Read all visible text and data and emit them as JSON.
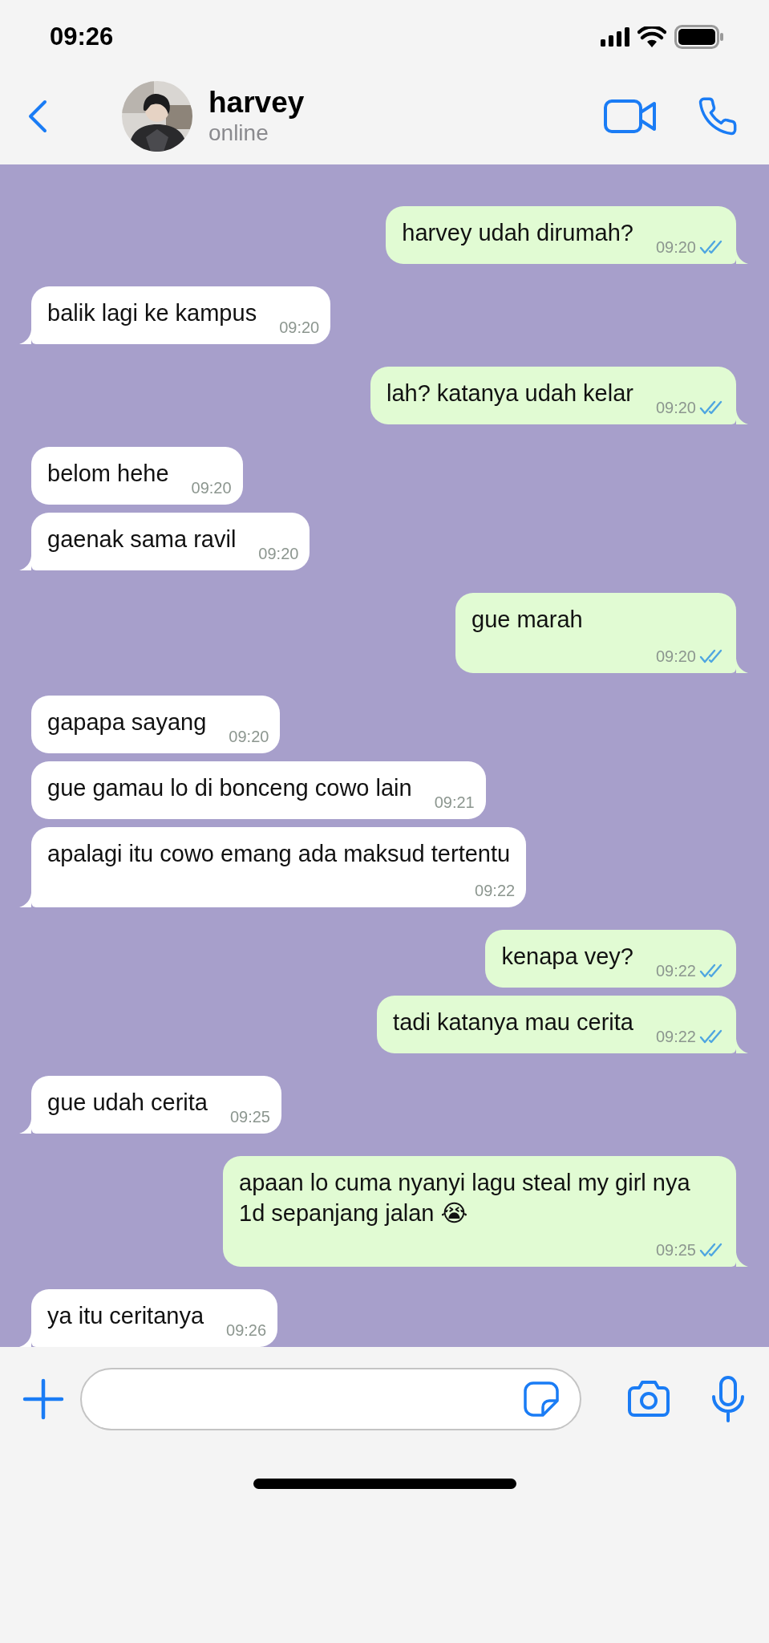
{
  "status_bar": {
    "time": "09:26"
  },
  "header": {
    "name": "harvey",
    "status": "online"
  },
  "messages": [
    {
      "kind": "sent",
      "text": "harvey udah dirumah?",
      "time": "09:20",
      "read": true,
      "tail": true,
      "time_below": false
    },
    {
      "kind": "received",
      "text": "balik lagi ke kampus",
      "time": "09:20",
      "tail": true,
      "time_below": false
    },
    {
      "kind": "sent",
      "text": "lah? katanya udah kelar",
      "time": "09:20",
      "read": true,
      "tail": true,
      "time_below": false
    },
    {
      "kind": "received",
      "text": "belom hehe",
      "time": "09:20",
      "tail": false,
      "time_below": false
    },
    {
      "kind": "received",
      "text": "gaenak sama ravil",
      "time": "09:20",
      "tail": true,
      "time_below": false
    },
    {
      "kind": "sent",
      "text": "gue marah",
      "time": "09:20",
      "read": true,
      "tail": true,
      "time_below": true
    },
    {
      "kind": "received",
      "text": "gapapa sayang",
      "time": "09:20",
      "tail": false,
      "time_below": false
    },
    {
      "kind": "received",
      "text": "gue gamau lo di bonceng cowo lain",
      "time": "09:21",
      "tail": false,
      "time_below": false
    },
    {
      "kind": "received",
      "text": "apalagi itu cowo emang ada maksud tertentu",
      "time": "09:22",
      "tail": true,
      "time_below": true
    },
    {
      "kind": "sent",
      "text": "kenapa vey?",
      "time": "09:22",
      "read": true,
      "tail": false,
      "time_below": false
    },
    {
      "kind": "sent",
      "text": "tadi katanya mau cerita",
      "time": "09:22",
      "read": true,
      "tail": true,
      "time_below": false
    },
    {
      "kind": "received",
      "text": "gue udah cerita",
      "time": "09:25",
      "tail": true,
      "time_below": false
    },
    {
      "kind": "sent",
      "text": "apaan lo cuma nyanyi lagu steal my girl nya 1d sepanjang jalan 😭",
      "time": "09:25",
      "read": true,
      "tail": true,
      "time_below": true
    },
    {
      "kind": "received",
      "text": "ya itu ceritanya",
      "time": "09:26",
      "tail": true,
      "time_below": false
    }
  ]
}
